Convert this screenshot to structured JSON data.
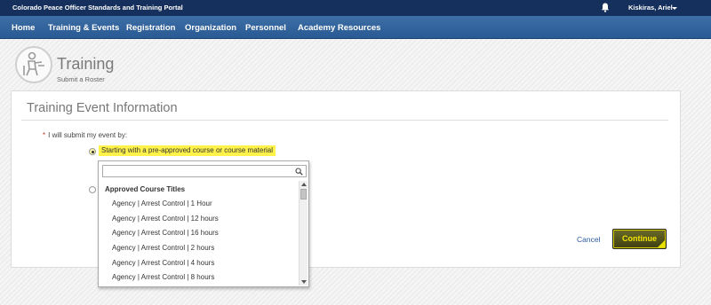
{
  "topbar": {
    "portal_title": "Colorado Peace Officer Standards and Training Portal",
    "bell_icon": "bell-icon",
    "user_name": "Kiskiras, Ariel"
  },
  "nav": {
    "items": [
      "Home",
      "Training & Events",
      "Registration",
      "Organization",
      "Personnel",
      "Academy Resources"
    ]
  },
  "page": {
    "icon": "training-person-icon",
    "title": "Training",
    "subtitle": "Submit a Roster"
  },
  "form": {
    "section_title": "Training Event Information",
    "required_marker": "*",
    "question": "I will submit my event by:",
    "option_1_label": "Starting with a pre-approved course or course material",
    "highlight_color": "#fff24a"
  },
  "dropdown": {
    "search_value": "",
    "search_icon": "search-icon",
    "group_label": "Approved Course Titles",
    "options": [
      "Agency | Arrest Control | 1 Hour",
      "Agency | Arrest Control | 12 hours",
      "Agency | Arrest Control | 16 hours",
      "Agency | Arrest Control | 2 hours",
      "Agency | Arrest Control | 4 hours",
      "Agency | Arrest Control | 8 hours"
    ]
  },
  "actions": {
    "cancel_label": "Cancel",
    "continue_label": "Continue",
    "continue_text_color": "#f3e600"
  },
  "colors": {
    "topbar": "#15305c",
    "navbar": "#2f6099",
    "link": "#2b5aa0"
  }
}
